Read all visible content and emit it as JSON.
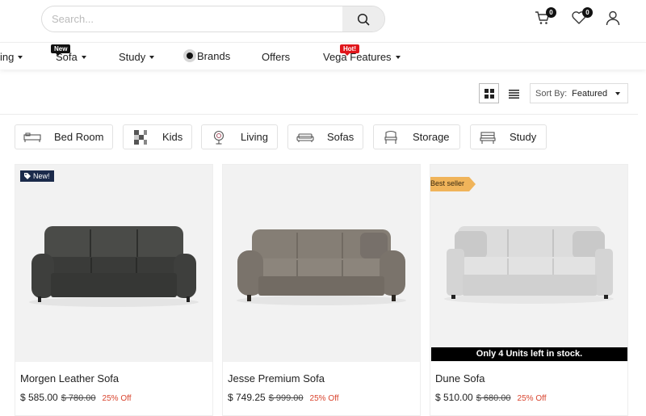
{
  "header": {
    "search_placeholder": "Search...",
    "cart_count": "0",
    "wishlist_count": "0"
  },
  "nav": {
    "items": [
      {
        "label": "ing"
      },
      {
        "label": "Sofa",
        "tag": "New"
      },
      {
        "label": "Study"
      },
      {
        "label": "Brands"
      },
      {
        "label": "Offers"
      },
      {
        "label": "Vega Features",
        "tag": "Hot!"
      }
    ]
  },
  "toolbar": {
    "sort_label": "Sort By:",
    "sort_value": "Featured"
  },
  "categories": [
    {
      "label": "Bed Room",
      "icon": "bed-icon"
    },
    {
      "label": "Kids",
      "icon": "kids-icon"
    },
    {
      "label": "Living",
      "icon": "living-icon"
    },
    {
      "label": "Sofas",
      "icon": "sofa-icon"
    },
    {
      "label": "Storage",
      "icon": "storage-icon"
    },
    {
      "label": "Study",
      "icon": "study-icon"
    }
  ],
  "products": [
    {
      "name": "Morgen Leather Sofa",
      "price": "$ 585.00",
      "old_price": "$ 780.00",
      "discount": "25% Off",
      "badge": "New!",
      "color": "#3e3f3d"
    },
    {
      "name": "Jesse Premium Sofa",
      "price": "$ 749.25",
      "old_price": "$ 999.00",
      "discount": "25% Off",
      "color": "#7a736b"
    },
    {
      "name": "Dune Sofa",
      "price": "$ 510.00",
      "old_price": "$ 680.00",
      "discount": "25% Off",
      "badge": "Best seller",
      "stock": "Only 4 Units left in stock.",
      "color": "#d8d8d8"
    }
  ],
  "colors": {
    "discount": "#d9442e",
    "new_badge": "#1b2a4a",
    "best_badge": "#f0b45a",
    "hot_tag": "#e0161b"
  }
}
